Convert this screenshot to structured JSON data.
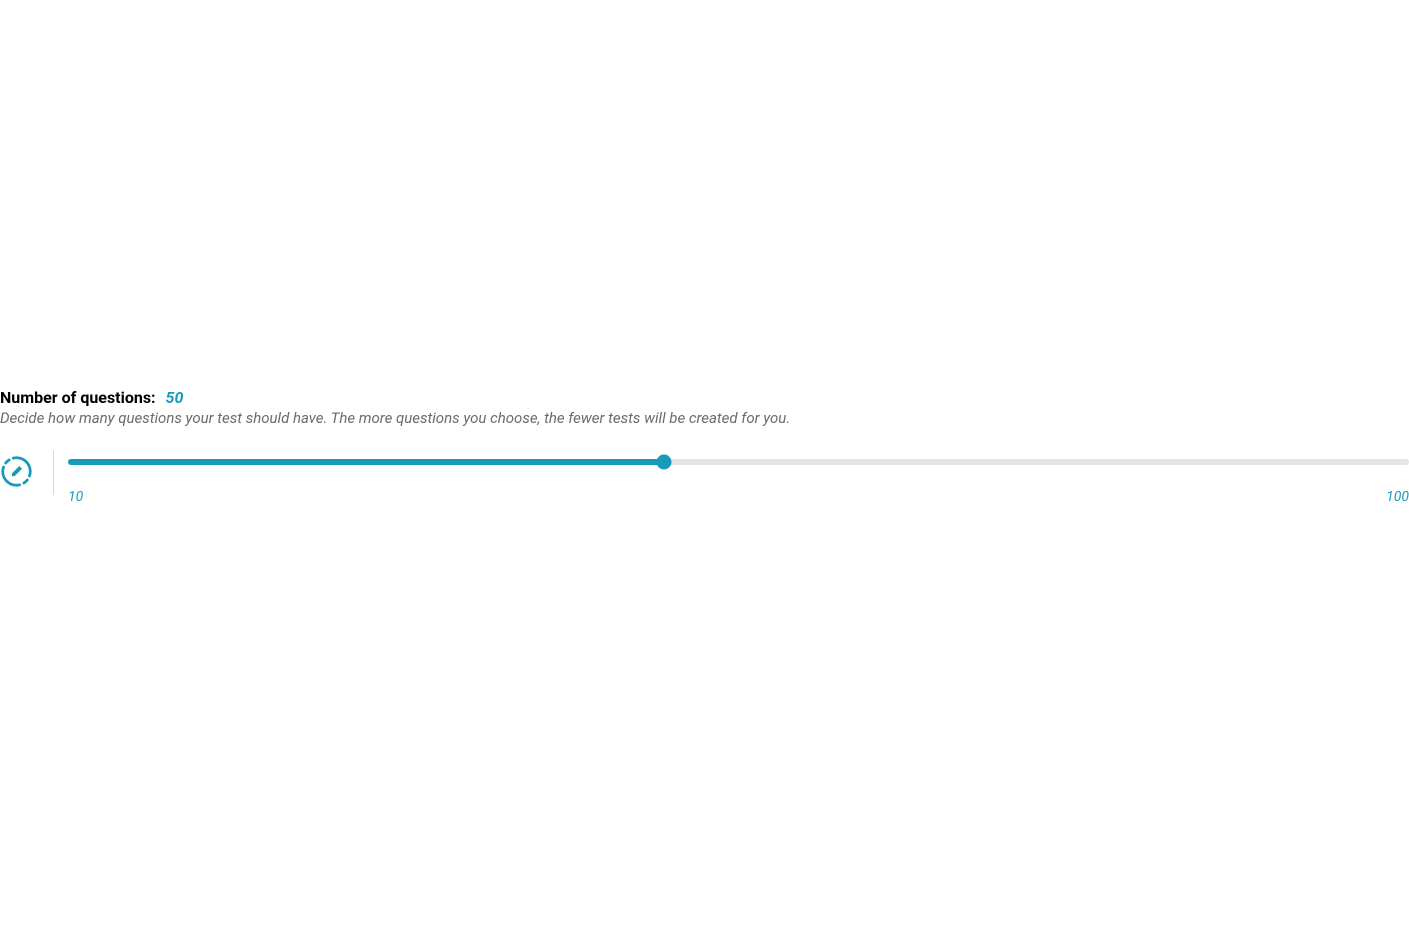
{
  "header": {
    "label": "Number of questions:",
    "value": "50"
  },
  "description": "Decide how many questions your test should have. The more questions you choose, the fewer tests will be created for you.",
  "slider": {
    "min": "10",
    "max": "100",
    "current": 50,
    "fill_percent": 44.44
  },
  "colors": {
    "accent": "#169cba",
    "text_muted": "#6b6b6b",
    "track_bg": "#e5e5e5"
  }
}
